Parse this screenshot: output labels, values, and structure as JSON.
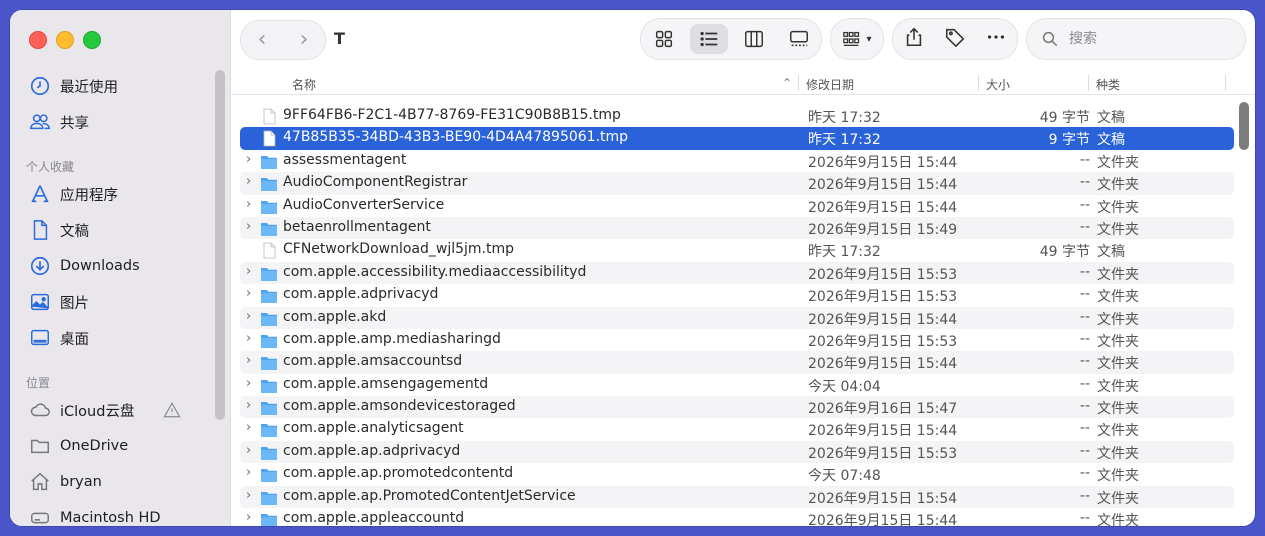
{
  "window": {
    "title": "T"
  },
  "sidebar": {
    "top_items": [
      {
        "label": "最近使用",
        "icon": "clock-icon"
      },
      {
        "label": "共享",
        "icon": "people-icon"
      }
    ],
    "favorites_header": "个人收藏",
    "favorites": [
      {
        "label": "应用程序",
        "icon": "apps-icon"
      },
      {
        "label": "文稿",
        "icon": "document-icon"
      },
      {
        "label": "Downloads",
        "icon": "download-icon"
      },
      {
        "label": "图片",
        "icon": "photo-icon"
      },
      {
        "label": "桌面",
        "icon": "desktop-icon"
      }
    ],
    "locations_header": "位置",
    "locations": [
      {
        "label": "iCloud云盘",
        "icon": "cloud-icon"
      },
      {
        "label": "OneDrive",
        "icon": "folder-icon"
      },
      {
        "label": "bryan",
        "icon": "home-icon"
      },
      {
        "label": "Macintosh HD",
        "icon": "disk-icon"
      }
    ]
  },
  "toolbar": {
    "search_placeholder": "搜索"
  },
  "columns": {
    "name": "名称",
    "date": "修改日期",
    "size": "大小",
    "kind": "种类"
  },
  "files": [
    {
      "name": "9FF64FB6-F2C1-4B77-8769-FE31C90B8B15.tmp",
      "date": "昨天 17:32",
      "size": "49 字节",
      "kind": "文稿",
      "folder": false
    },
    {
      "name": "47B85B35-34BD-43B3-BE90-4D4A47895061.tmp",
      "date": "昨天 17:32",
      "size": "9 字节",
      "kind": "文稿",
      "folder": false,
      "selected": true
    },
    {
      "name": "assessmentagent",
      "date": "2026年9月15日 15:44",
      "size": "--",
      "kind": "文件夹",
      "folder": true
    },
    {
      "name": "AudioComponentRegistrar",
      "date": "2026年9月15日 15:44",
      "size": "--",
      "kind": "文件夹",
      "folder": true
    },
    {
      "name": "AudioConverterService",
      "date": "2026年9月15日 15:44",
      "size": "--",
      "kind": "文件夹",
      "folder": true
    },
    {
      "name": "betaenrollmentagent",
      "date": "2026年9月15日 15:49",
      "size": "--",
      "kind": "文件夹",
      "folder": true
    },
    {
      "name": "CFNetworkDownload_wjl5jm.tmp",
      "date": "昨天 17:32",
      "size": "49 字节",
      "kind": "文稿",
      "folder": false
    },
    {
      "name": "com.apple.accessibility.mediaaccessibilityd",
      "date": "2026年9月15日 15:53",
      "size": "--",
      "kind": "文件夹",
      "folder": true
    },
    {
      "name": "com.apple.adprivacyd",
      "date": "2026年9月15日 15:53",
      "size": "--",
      "kind": "文件夹",
      "folder": true
    },
    {
      "name": "com.apple.akd",
      "date": "2026年9月15日 15:44",
      "size": "--",
      "kind": "文件夹",
      "folder": true
    },
    {
      "name": "com.apple.amp.mediasharingd",
      "date": "2026年9月15日 15:53",
      "size": "--",
      "kind": "文件夹",
      "folder": true
    },
    {
      "name": "com.apple.amsaccountsd",
      "date": "2026年9月15日 15:44",
      "size": "--",
      "kind": "文件夹",
      "folder": true
    },
    {
      "name": "com.apple.amsengagementd",
      "date": "今天 04:04",
      "size": "--",
      "kind": "文件夹",
      "folder": true
    },
    {
      "name": "com.apple.amsondevicestoraged",
      "date": "2026年9月16日 15:47",
      "size": "--",
      "kind": "文件夹",
      "folder": true
    },
    {
      "name": "com.apple.analyticsagent",
      "date": "2026年9月15日 15:44",
      "size": "--",
      "kind": "文件夹",
      "folder": true
    },
    {
      "name": "com.apple.ap.adprivacyd",
      "date": "2026年9月15日 15:53",
      "size": "--",
      "kind": "文件夹",
      "folder": true
    },
    {
      "name": "com.apple.ap.promotedcontentd",
      "date": "今天 07:48",
      "size": "--",
      "kind": "文件夹",
      "folder": true
    },
    {
      "name": "com.apple.ap.PromotedContentJetService",
      "date": "2026年9月15日 15:54",
      "size": "--",
      "kind": "文件夹",
      "folder": true
    },
    {
      "name": "com.apple.appleaccountd",
      "date": "2026年9月15日 15:44",
      "size": "--",
      "kind": "文件夹",
      "folder": true
    }
  ]
}
